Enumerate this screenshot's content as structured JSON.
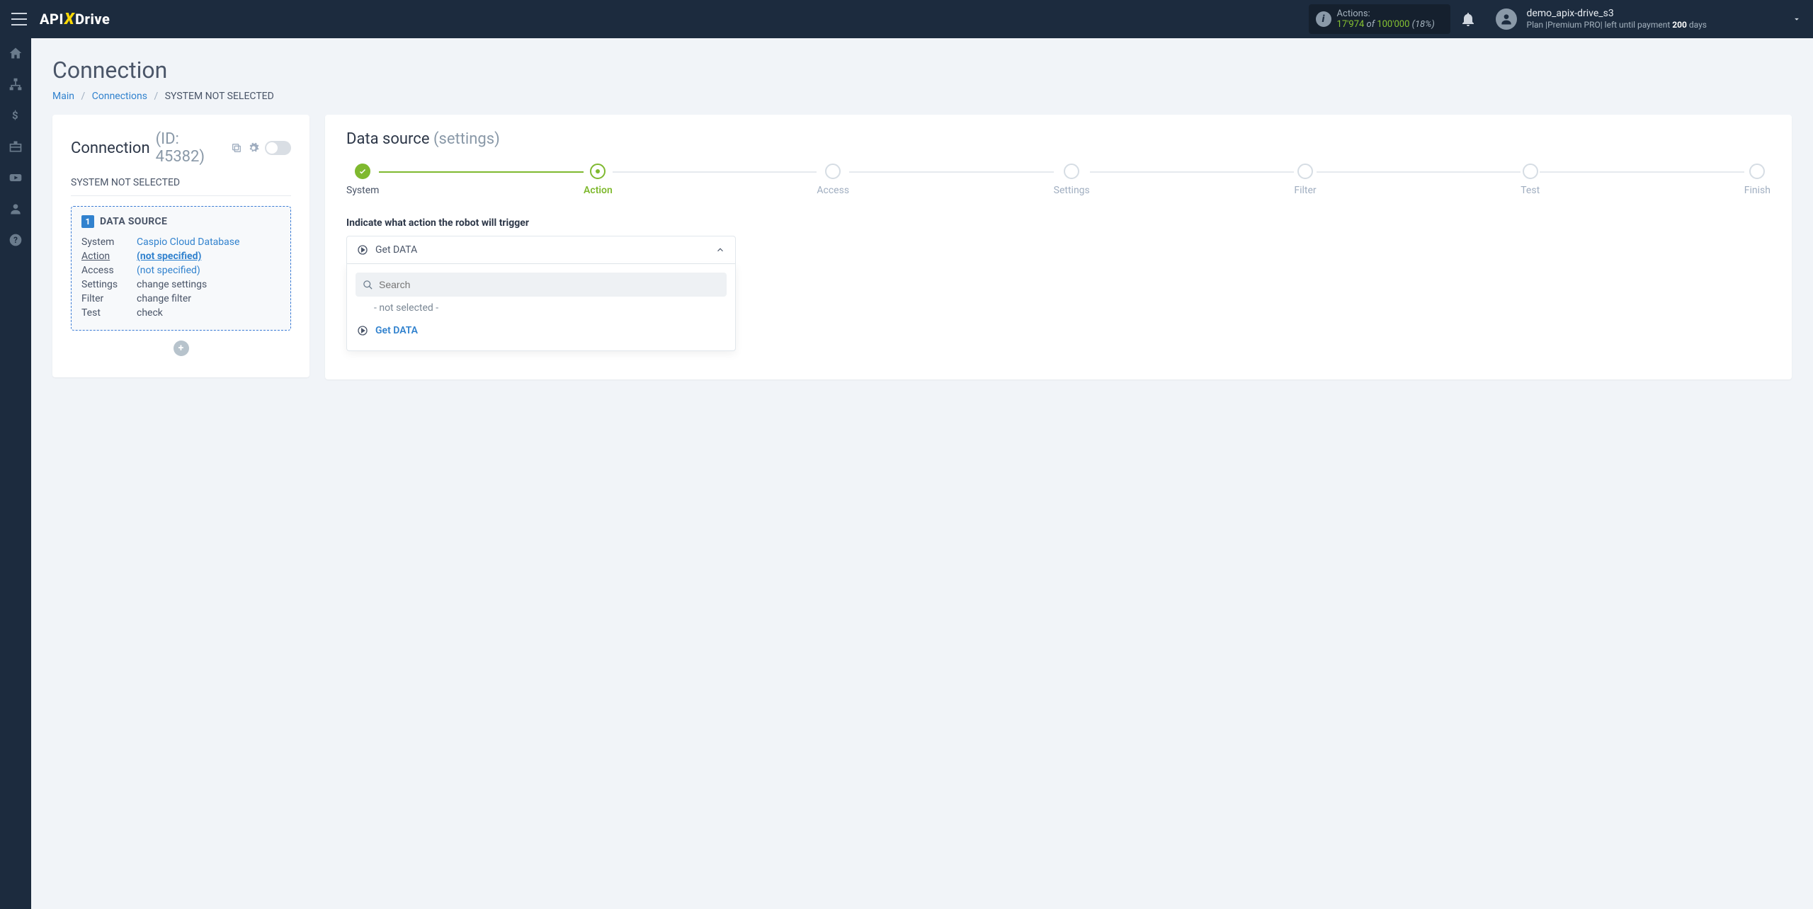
{
  "header": {
    "logo": {
      "p1": "API",
      "p2": "X",
      "p3": "Drive"
    },
    "actions": {
      "label": "Actions:",
      "used": "17'974",
      "of": " of ",
      "total": "100'000",
      "pct": "(18%)"
    },
    "user": {
      "name": "demo_apix-drive_s3",
      "plan_prefix": "Plan |",
      "plan_name": "Premium PRO",
      "plan_mid": "| left until payment ",
      "days": "200",
      "days_suffix": " days"
    }
  },
  "page": {
    "title": "Connection",
    "breadcrumb": {
      "main": "Main",
      "connections": "Connections",
      "current": "SYSTEM NOT SELECTED"
    }
  },
  "left": {
    "title": "Connection",
    "id_label": "(ID: 45382)",
    "subhead": "SYSTEM NOT SELECTED",
    "ds_badge": "1",
    "ds_title": "DATA SOURCE",
    "rows": {
      "system_k": "System",
      "system_v": "Caspio Cloud Database",
      "action_k": "Action",
      "action_v": "(not specified)",
      "access_k": "Access",
      "access_v": "(not specified)",
      "settings_k": "Settings",
      "settings_v": "change settings",
      "filter_k": "Filter",
      "filter_v": "change filter",
      "test_k": "Test",
      "test_v": "check"
    }
  },
  "right": {
    "title1": "Data source",
    "title2": "(settings)",
    "steps": [
      "System",
      "Action",
      "Access",
      "Settings",
      "Filter",
      "Test",
      "Finish"
    ],
    "instruction": "Indicate what action the robot will trigger",
    "dd_value": "Get DATA",
    "search_placeholder": "Search",
    "opt_none": "- not selected -",
    "opt_get": "Get DATA"
  }
}
